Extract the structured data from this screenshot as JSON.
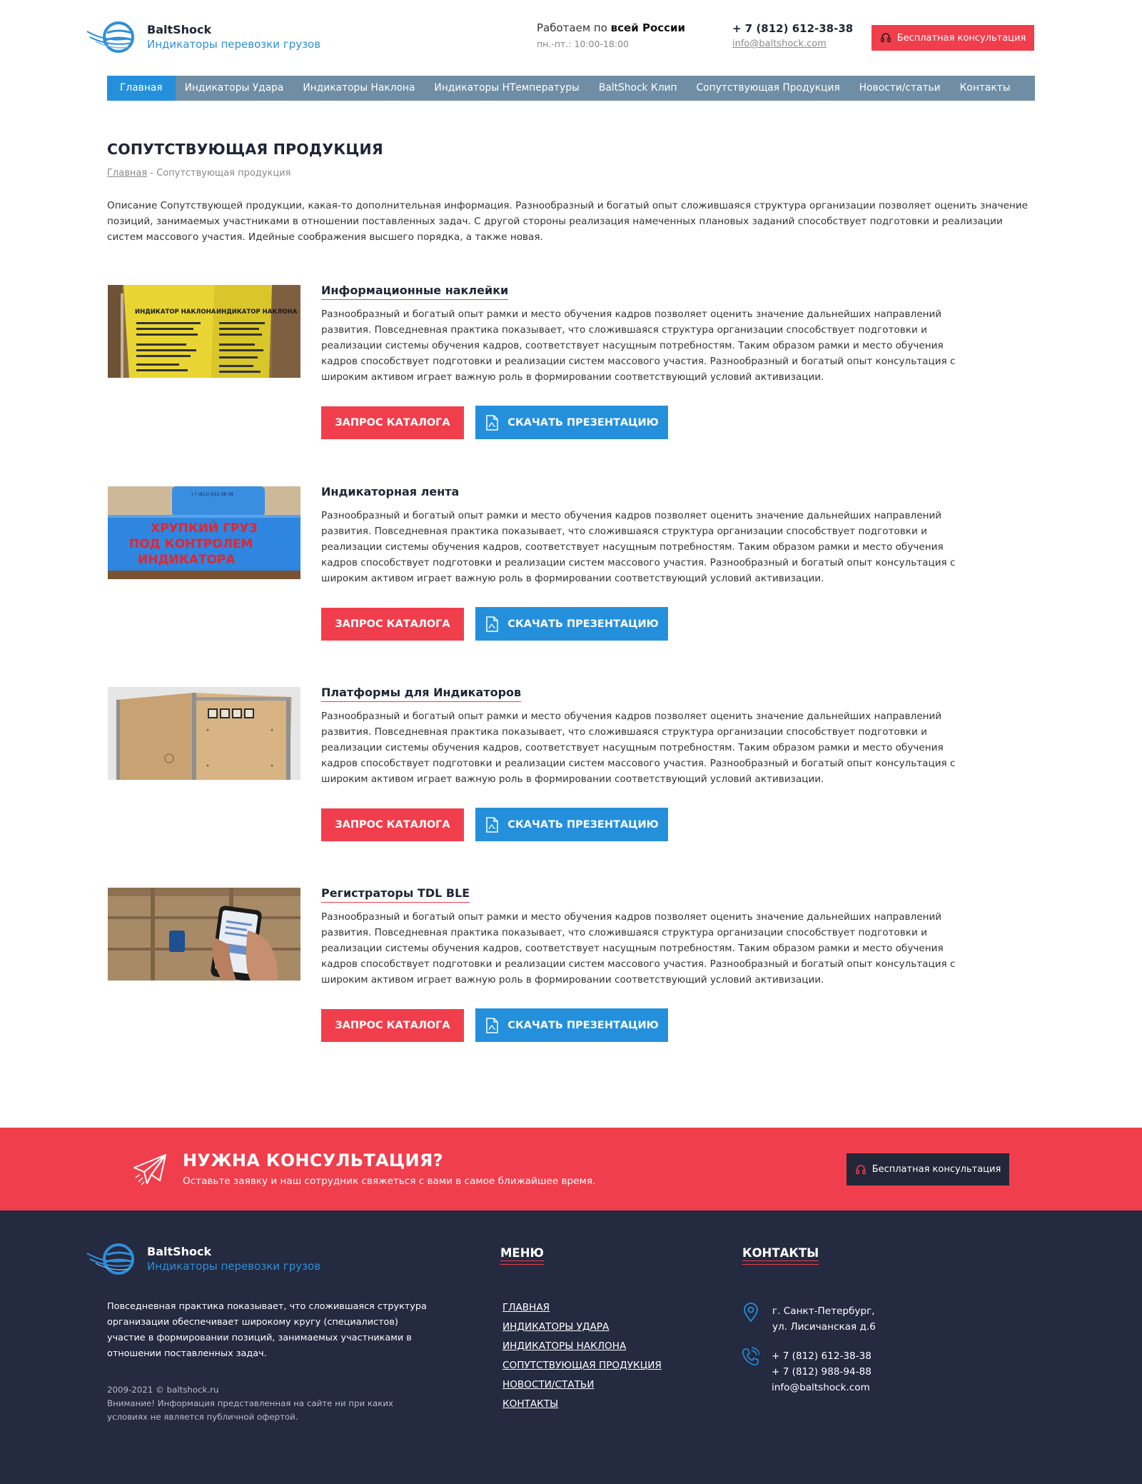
{
  "brand": {
    "name": "BaltShock",
    "tagline": "Индикаторы перевозки грузов"
  },
  "header": {
    "work_prefix": "Работаем по ",
    "work_bold": "всей России",
    "hours": "пн.-пт.: 10:00-18:00",
    "phone": "+ 7 (812) 612-38-38",
    "email": "info@baltshock.com",
    "consult_button": "Бесплатная консультация"
  },
  "nav": {
    "items": [
      {
        "label": "Главная",
        "active": true
      },
      {
        "label": "Индикаторы Удара"
      },
      {
        "label": "Индикаторы Наклона"
      },
      {
        "label": "Индикаторы НТемпературы"
      },
      {
        "label": "BaltShock Клип"
      },
      {
        "label": "Сопутствующая Продукция"
      },
      {
        "label": "Новости/статьи"
      },
      {
        "label": "Контакты"
      }
    ]
  },
  "page": {
    "title": "СОПУТСТВУЮЩАЯ ПРОДУКЦИЯ",
    "breadcrumb_home": "Главная",
    "breadcrumb_current": " - Сопутствующая продукция",
    "intro": "Описание Сопутствующей продукции, какая-то дополнительная информация. Разнообразный и богатый опыт сложившаяся структура организации позволяет оценить значение позиций, занимаемых участниками в отношении поставленных задач. С другой стороны реализация намеченных плановых заданий способствует подготовки и реализации систем массового участия. Идейные соображения высшего порядка, а также новая."
  },
  "products": [
    {
      "title": "Информационные наклейки",
      "description": "Разнообразный и богатый опыт рамки и место обучения кадров позволяет оценить значение дальнейших направлений развития. Повседневная практика показывает, что сложившаяся структура организации способствует подготовки и реализации системы обучения кадров, соответствует насущным потребностям. Таким образом рамки и место обучения кадров способствует подготовки и реализации систем массового участия. Разнообразный и богатый опыт консультация с широким активом играет важную роль в формировании соответствующий условий активизации.",
      "image_text_1": "ИНДИКАТОР НАКЛОНА",
      "image_text_2": "ИНДИКАТОР НАКЛОНА"
    },
    {
      "title": "Индикаторная лента",
      "description": "Разнообразный и богатый опыт рамки и место обучения кадров позволяет оценить значение дальнейших направлений развития. Повседневная практика показывает, что сложившаяся структура организации способствует подготовки и реализации системы обучения кадров, соответствует насущным потребностям. Таким образом рамки и место обучения кадров способствует подготовки и реализации систем массового участия. Разнообразный и богатый опыт консультация с широким активом играет важную роль в формировании соответствующий условий активизации.",
      "image_text_1": "ХРУПКИЙ ГРУЗ",
      "image_text_2": "ПОД КОНТРОЛЕМ",
      "image_text_3": "ИНДИКАТОРА"
    },
    {
      "title": "Платформы для Индикаторов",
      "description": "Разнообразный и богатый опыт рамки и место обучения кадров позволяет оценить значение дальнейших направлений развития. Повседневная практика показывает, что сложившаяся структура организации способствует подготовки и реализации системы обучения кадров, соответствует насущным потребностям. Таким образом рамки и место обучения кадров способствует подготовки и реализации систем массового участия. Разнообразный и богатый опыт консультация с широким активом играет важную роль в формировании соответствующий условий активизации."
    },
    {
      "title": "Регистраторы TDL BLE",
      "description": "Разнообразный и богатый опыт рамки и место обучения кадров позволяет оценить значение дальнейших направлений развития. Повседневная практика показывает, что сложившаяся структура организации способствует подготовки и реализации системы обучения кадров, соответствует насущным потребностям. Таким образом рамки и место обучения кадров способствует подготовки и реализации систем массового участия. Разнообразный и богатый опыт консультация с широким активом играет важную роль в формировании соответствующий условий активизации."
    }
  ],
  "product_buttons": {
    "catalog": "ЗАПРОС КАТАЛОГА",
    "presentation": "СКАЧАТЬ ПРЕЗЕНТАЦИЮ"
  },
  "cta": {
    "title": "НУЖНА КОНСУЛЬТАЦИЯ?",
    "subtitle": "Оставьте заявку и наш сотрудник свяжеться с вами в самое ближайшее время.",
    "button": "Бесплатная консультация"
  },
  "footer": {
    "about": "Повседневная практика показывает, что сложившаяся структура организации обеспечивает широкому кругу (специалистов) участие в формировании позиций, занимаемых участниками в отношении поставленных задач.",
    "copyright": "2009-2021  © baltshock.ru",
    "disclaimer": "Внимание! Информация представленная на сайте ни при каких условиях не является публичной офертой.",
    "menu_title": "МЕНЮ",
    "menu": [
      "ГЛАВНАЯ",
      "ИНДИКАТОРЫ УДАРА",
      "ИНДИКАТОРЫ НАКЛОНА",
      "СОПУТСТВУЮЩАЯ ПРОДУКЦИЯ",
      "НОВОСТИ/СТАТЬИ",
      "КОНТАКТЫ"
    ],
    "contacts_title": "КОНТАКТЫ",
    "address_1": "г. Санкт-Петербург,",
    "address_2": "ул. Лисичанская д.6",
    "phone_1": "+ 7 (812) 612-38-38",
    "phone_2": "+ 7 (812) 988-94-88",
    "email": "info@baltshock.com"
  },
  "colors": {
    "accent_red": "#f03e4c",
    "accent_blue": "#2490dc",
    "nav_bg": "#6f8ea6",
    "footer_bg": "#242a40"
  },
  "icons": {
    "logo": "globe-swoosh-logo-icon",
    "consult": "headset-icon",
    "pdf": "pdf-file-icon",
    "plane": "paper-plane-icon",
    "address": "map-pin-icon",
    "phone": "phone-icon"
  }
}
